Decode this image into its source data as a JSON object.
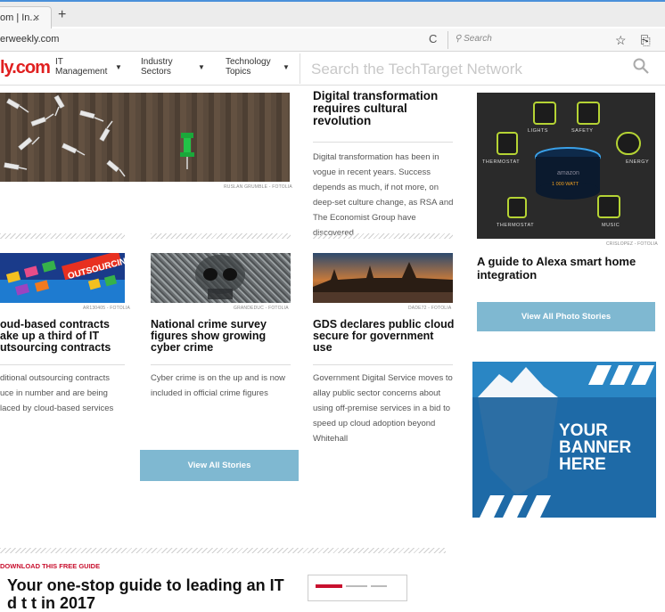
{
  "browser": {
    "tab_title": "om | In...",
    "tab_close": "×",
    "new_tab": "+",
    "url": "erweekly.com",
    "reload": "C",
    "search_placeholder": "Search",
    "toolbar_icons": "☆ ⎘ ⬇"
  },
  "site_nav": {
    "logo": "ly.com",
    "items": [
      {
        "line1": "IT",
        "line2": "Management"
      },
      {
        "line1": "Industry",
        "line2": "Sectors"
      },
      {
        "line1": "Technology",
        "line2": "Topics"
      }
    ],
    "search_placeholder": "Search the TechTarget Network"
  },
  "hero": {
    "credit": "RUSLAN GRUMBLE - FOTOLIA",
    "headline": "Digital transformation requires cultural revolution",
    "body": "Digital transformation has been in vogue in recent years. Success depends as much, if not more, on deep-set culture change, as RSA and The Economist Group have discovered"
  },
  "stories": [
    {
      "image_text": "OUTSOURCING",
      "credit": "AR130405 - FOTOLIA",
      "headline": "oud-based contracts ake up a third of IT utsourcing contracts",
      "body": "ditional outsourcing contracts uce in number and are being laced by cloud-based services"
    },
    {
      "credit": "GRANDEDUC - FOTOLIA",
      "headline": "National crime survey figures show growing cyber crime",
      "body": "Cyber crime is on the up and is now included in official crime figures"
    },
    {
      "credit": "DADE72 - FOTOLIA",
      "headline": "GDS declares public cloud secure for government use",
      "body": "Government Digital Service moves to allay public sector concerns about using off-premise services in a bid to speed up cloud adoption beyond Whitehall"
    }
  ],
  "view_all_stories": "View All Stories",
  "alexa": {
    "labels": {
      "lights": "LIGHTS",
      "safety": "SAFETY",
      "thermostat_top": "THERMOSTAT",
      "energy": "ENERGY",
      "thermostat_bottom": "THERMOSTAT",
      "music": "MUSIC",
      "device_brand": "amazon",
      "device_sub": "1 000 WATT"
    },
    "credit": "CRISLOPEZ - FOTOLIA",
    "headline": "A guide to Alexa smart home integration"
  },
  "view_all_photo_stories": "View All Photo Stories",
  "banner": {
    "text": "YOUR\nBANNER\nHERE"
  },
  "guide": {
    "kicker": "DOWNLOAD THIS FREE GUIDE",
    "title": "Your one-stop guide to leading an IT\nd        t      t    in 2017"
  },
  "colors": {
    "accent_button": "#7fb8d1",
    "logo_red": "#e02020",
    "kicker_red": "#c8102e",
    "banner_blue": "#1e6aa7",
    "alexa_green": "#b5d334"
  }
}
